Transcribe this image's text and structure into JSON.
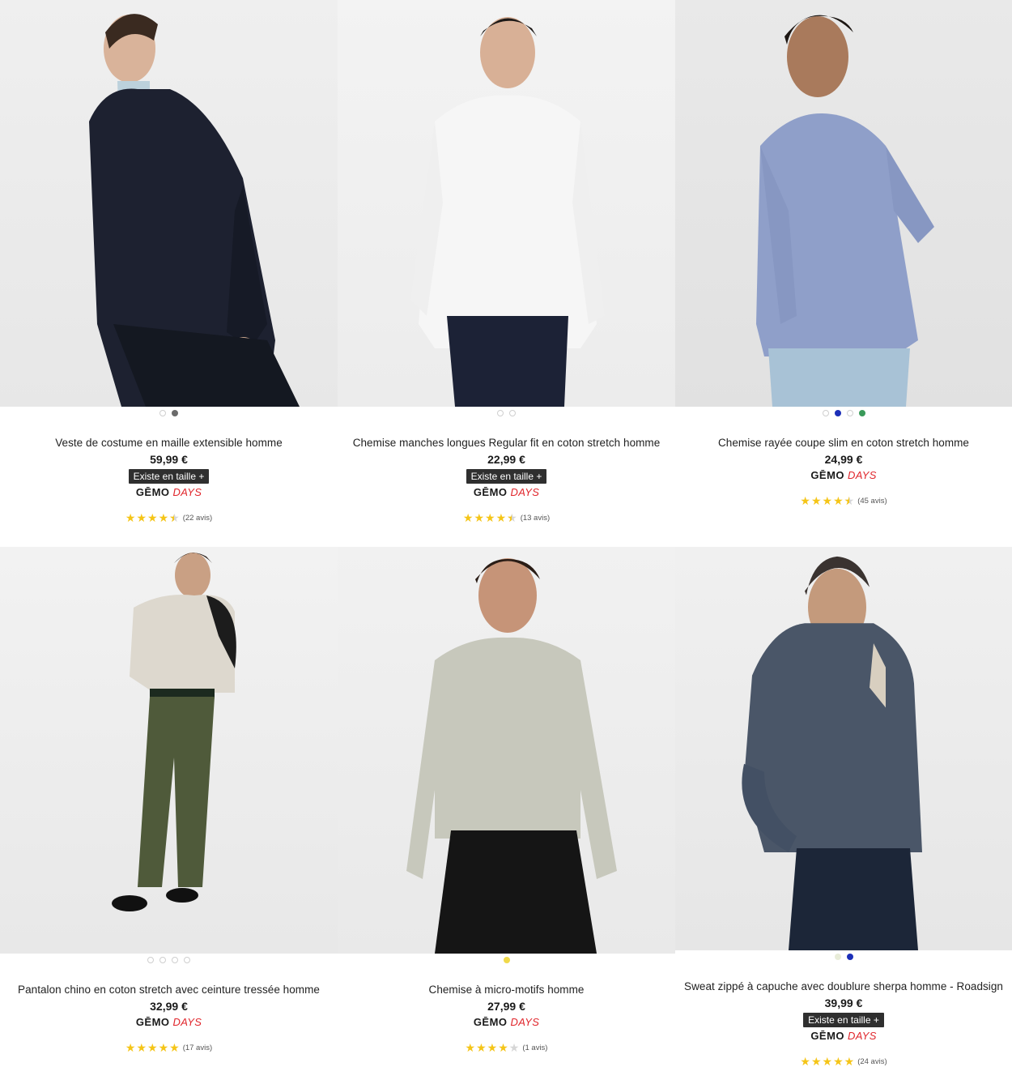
{
  "products": [
    {
      "title": "Veste de costume en maille extensible homme",
      "price": "59,99 €",
      "size_badge": "Existe en taille +",
      "promo_brand": "GĒMO",
      "promo_days": "DAYS",
      "rating": 4.5,
      "reviews": "(22 avis)",
      "swatches": [
        "#ffffff",
        "#6b6b6b"
      ]
    },
    {
      "title": "Chemise manches longues Regular fit en coton stretch homme",
      "price": "22,99 €",
      "size_badge": "Existe en taille +",
      "promo_brand": "GĒMO",
      "promo_days": "DAYS",
      "rating": 4.5,
      "reviews": "(13 avis)",
      "swatches": [
        "#ffffff",
        "#ffffff"
      ]
    },
    {
      "title": "Chemise rayée coupe slim en coton stretch homme",
      "price": "24,99 €",
      "size_badge": "",
      "promo_brand": "GĒMO",
      "promo_days": "DAYS",
      "rating": 4.5,
      "reviews": "(45 avis)",
      "swatches": [
        "#ffffff",
        "#1c2fb8",
        "#ffffff",
        "#3a9a5a"
      ]
    },
    {
      "title": "Pantalon chino en coton stretch avec ceinture tressée homme",
      "price": "32,99 €",
      "size_badge": "",
      "promo_brand": "GĒMO",
      "promo_days": "DAYS",
      "rating": 5,
      "reviews": "(17 avis)",
      "swatches": [
        "#ffffff",
        "#ffffff",
        "#ffffff",
        "#ffffff"
      ]
    },
    {
      "title": "Chemise à micro-motifs homme",
      "price": "27,99 €",
      "size_badge": "",
      "promo_brand": "GĒMO",
      "promo_days": "DAYS",
      "rating": 4,
      "reviews": "(1 avis)",
      "swatches": [
        "#f0d94a"
      ]
    },
    {
      "title": "Sweat zippé à capuche avec doublure sherpa homme - Roadsign",
      "price": "39,99 €",
      "size_badge": "Existe en taille +",
      "promo_brand": "GĒMO",
      "promo_days": "DAYS",
      "rating": 5,
      "reviews": "(24 avis)",
      "swatches": [
        "#e8ecd8",
        "#1c2fb8"
      ]
    }
  ],
  "colors": {
    "star": "#f5c518",
    "days_red": "#e0262c",
    "badge_bg": "#2f2f2f"
  },
  "icons": {
    "rating": "star-icon",
    "product_photo": "product-image"
  }
}
